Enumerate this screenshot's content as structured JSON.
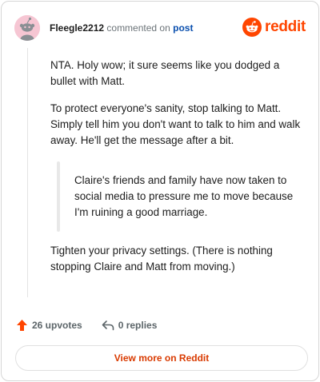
{
  "header": {
    "author": "Fleegle2212",
    "action": "commented on",
    "post_link": "post",
    "brand": "reddit"
  },
  "comment": {
    "paragraph_1": "NTA. Holy wow; it sure seems like you dodged a bullet with Matt.",
    "paragraph_2": "To protect everyone's sanity, stop talking to Matt. Simply tell him you don't want to talk to him and walk away. He'll get the message after a bit.",
    "quote": "Claire's friends and family have now taken to social media to pressure me to move because I'm ruining a good marriage.",
    "paragraph_3": "Tighten your privacy settings. (There is nothing stopping Claire and Matt from moving.)"
  },
  "footer": {
    "upvotes": "26 upvotes",
    "replies": "0 replies"
  },
  "view_more_label": "View more on Reddit",
  "colors": {
    "brand_orange": "#ff4500",
    "link_blue": "#0a4fae",
    "button_text": "#d93a00"
  },
  "icons": {
    "avatar": "snoo-avatar-icon",
    "logo": "reddit-logo-icon",
    "upvote": "upvote-arrow-icon",
    "reply": "reply-arrow-icon"
  }
}
